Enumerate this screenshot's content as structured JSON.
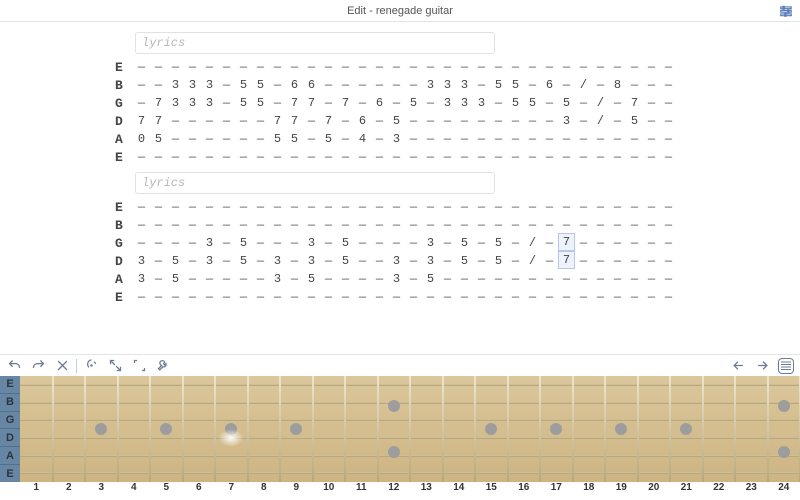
{
  "header": {
    "title": "Edit - renegade guitar"
  },
  "lyrics_placeholder": "lyrics",
  "strings": [
    "E",
    "B",
    "G",
    "D",
    "A",
    "E"
  ],
  "columns": 32,
  "blocks": [
    {
      "lyrics": "",
      "rows": [
        [],
        [
          null,
          null,
          "3",
          "3",
          "3",
          null,
          "5",
          "5",
          null,
          "6",
          "6",
          null,
          null,
          null,
          null,
          null,
          null,
          "3",
          "3",
          "3",
          null,
          "5",
          "5",
          null,
          "6",
          null,
          "/",
          null,
          "8",
          null
        ],
        [
          null,
          "7",
          "3",
          "3",
          "3",
          null,
          "5",
          "5",
          null,
          "7",
          "7",
          null,
          "7",
          null,
          "6",
          null,
          "5",
          null,
          "3",
          "3",
          "3",
          null,
          "5",
          "5",
          null,
          "5",
          null,
          "/",
          null,
          "7",
          null
        ],
        [
          "7",
          "7",
          null,
          null,
          null,
          null,
          null,
          null,
          "7",
          "7",
          null,
          "7",
          null,
          "6",
          null,
          "5",
          null,
          null,
          null,
          null,
          null,
          null,
          null,
          null,
          null,
          "3",
          null,
          "/",
          null,
          "5",
          null
        ],
        [
          "0",
          "5",
          null,
          null,
          null,
          null,
          null,
          null,
          "5",
          "5",
          null,
          "5",
          null,
          "4",
          null,
          "3",
          null,
          null,
          null,
          null,
          null,
          null,
          null,
          null,
          null,
          null,
          null,
          null,
          null,
          null
        ],
        []
      ],
      "selected": []
    },
    {
      "lyrics": "",
      "rows": [
        [],
        [],
        [
          null,
          null,
          null,
          null,
          "3",
          null,
          "5",
          null,
          null,
          null,
          "3",
          null,
          "5",
          null,
          null,
          null,
          null,
          "3",
          null,
          "5",
          null,
          "5",
          null,
          "/",
          null,
          "7",
          null
        ],
        [
          "3",
          null,
          "5",
          null,
          "3",
          null,
          "5",
          null,
          "3",
          null,
          "3",
          null,
          "5",
          null,
          null,
          "3",
          null,
          "3",
          null,
          "5",
          null,
          "5",
          null,
          "/",
          null,
          "7",
          null
        ],
        [
          "3",
          null,
          "5",
          null,
          null,
          null,
          null,
          null,
          "3",
          null,
          "5",
          null,
          null,
          null,
          null,
          "3",
          null,
          "5",
          null
        ],
        []
      ],
      "selected": [
        [
          2,
          25
        ],
        [
          3,
          25
        ]
      ]
    }
  ],
  "toolbar": {
    "undo": "undo",
    "redo": "redo",
    "cut": "cut",
    "chord": "chord",
    "fullscreen": "fullscreen",
    "resize": "resize",
    "tools": "tools",
    "left": "prev",
    "right": "next",
    "keyboard": "keyboard"
  },
  "fretboard": {
    "frets": 24,
    "dot_single": [
      3,
      5,
      7,
      9,
      15,
      17,
      19,
      21
    ],
    "dot_double": [
      12,
      24
    ],
    "glow": {
      "fret": 7,
      "string": 4
    }
  }
}
